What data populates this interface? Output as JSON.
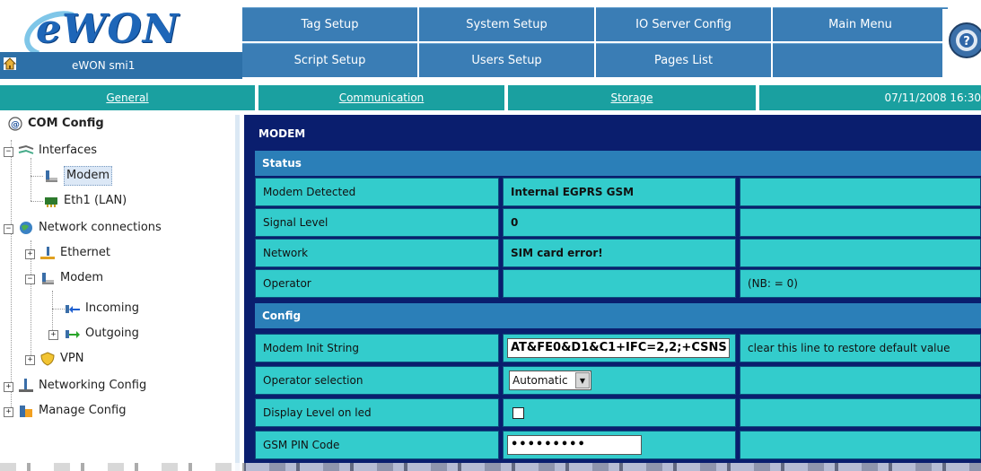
{
  "header": {
    "logo_text": "eWON",
    "device_name": "eWON smi1",
    "nav": [
      "Tag Setup",
      "System Setup",
      "IO Server Config",
      "Main Menu",
      "Script Setup",
      "Users Setup",
      "Pages List",
      ""
    ]
  },
  "tabs": {
    "general": "General",
    "communication": "Communication",
    "storage": "Storage",
    "datetime": "07/11/2008 16:30"
  },
  "tree": {
    "root": "COM Config",
    "interfaces": "Interfaces",
    "modem": "Modem",
    "eth1": "Eth1 (LAN)",
    "network_connections": "Network connections",
    "ethernet": "Ethernet",
    "modem2": "Modem",
    "incoming": "Incoming",
    "outgoing": "Outgoing",
    "vpn": "VPN",
    "networking_config": "Networking Config",
    "manage_config": "Manage Config"
  },
  "main": {
    "section_title": "MODEM",
    "status_header": "Status",
    "config_header": "Config",
    "status_rows": [
      {
        "label": "Modem Detected",
        "value": "Internal EGPRS GSM",
        "extra": ""
      },
      {
        "label": "Signal Level",
        "value": "0",
        "extra": ""
      },
      {
        "label": "Network",
        "value": "SIM card error!",
        "extra": ""
      },
      {
        "label": "Operator",
        "value": "",
        "extra": "(NB: = 0)"
      }
    ],
    "config_rows": {
      "init_string": {
        "label": "Modem Init String",
        "value": "AT&FE0&D1&C1+IFC=2,2;+CSNS",
        "hint": "clear this line to restore default value"
      },
      "operator_selection": {
        "label": "Operator selection",
        "value": "Automatic"
      },
      "display_level": {
        "label": "Display Level on led",
        "checked": false
      },
      "gsm_pin": {
        "label": "GSM PIN Code",
        "value": "•••••••••"
      }
    }
  },
  "colors": {
    "nav_blue": "#3a7db5",
    "tab_teal": "#1aa0a0",
    "panel_navy": "#0a1e6e",
    "group_header": "#2b7fb8",
    "cell_cyan": "#33cccc"
  }
}
